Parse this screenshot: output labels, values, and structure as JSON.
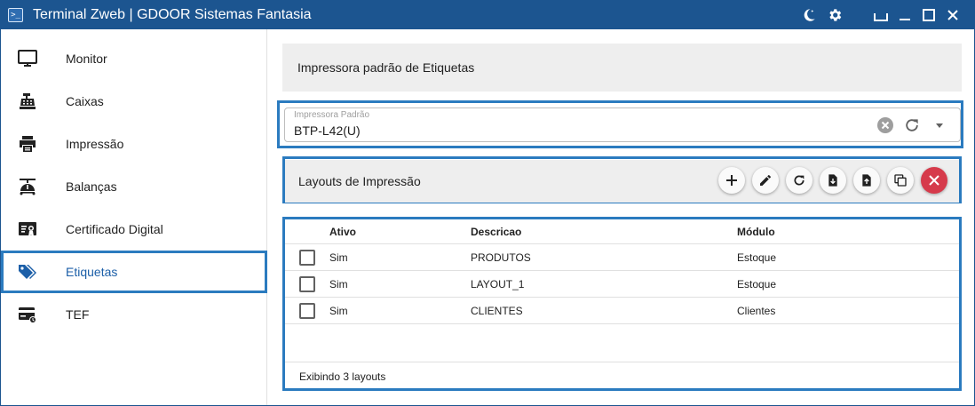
{
  "window": {
    "title": "Terminal Zweb | GDOOR Sistemas Fantasia",
    "icon": "terminal-prompt-icon",
    "controls": [
      "moon-icon",
      "gear-icon",
      "restore-bottom-icon",
      "minimize-icon",
      "maximize-icon",
      "close-icon"
    ]
  },
  "sidebar": {
    "items": [
      {
        "label": "Monitor",
        "icon": "monitor-icon"
      },
      {
        "label": "Caixas",
        "icon": "cash-register-icon"
      },
      {
        "label": "Impressão",
        "icon": "printer-icon"
      },
      {
        "label": "Balanças",
        "icon": "scale-icon"
      },
      {
        "label": "Certificado Digital",
        "icon": "certificate-icon"
      },
      {
        "label": "Etiquetas",
        "icon": "tags-icon",
        "active": true
      },
      {
        "label": "TEF",
        "icon": "card-terminal-icon"
      }
    ]
  },
  "printer": {
    "header": "Impressora padrão de Etiquetas",
    "field_label": "Impressora Padrão",
    "field_value": "BTP-L42(U)"
  },
  "layouts": {
    "title": "Layouts de Impressão",
    "actions": [
      "add-icon",
      "edit-icon",
      "refresh-icon",
      "file-import-icon",
      "file-export-icon",
      "duplicate-icon",
      "delete-icon"
    ],
    "columns": {
      "active": "Ativo",
      "description": "Descricao",
      "module": "Módulo"
    },
    "rows": [
      {
        "active": "Sim",
        "description": "PRODUTOS",
        "module": "Estoque"
      },
      {
        "active": "Sim",
        "description": "LAYOUT_1",
        "module": "Estoque"
      },
      {
        "active": "Sim",
        "description": "CLIENTES",
        "module": "Clientes"
      }
    ],
    "footer": "Exibindo 3 layouts"
  },
  "colors": {
    "titlebar": "#1c5590",
    "highlight": "#2b7bbf",
    "active_text": "#1c5fa8",
    "delete_button": "#d63a4b",
    "panel_bg": "#eeeeee"
  }
}
